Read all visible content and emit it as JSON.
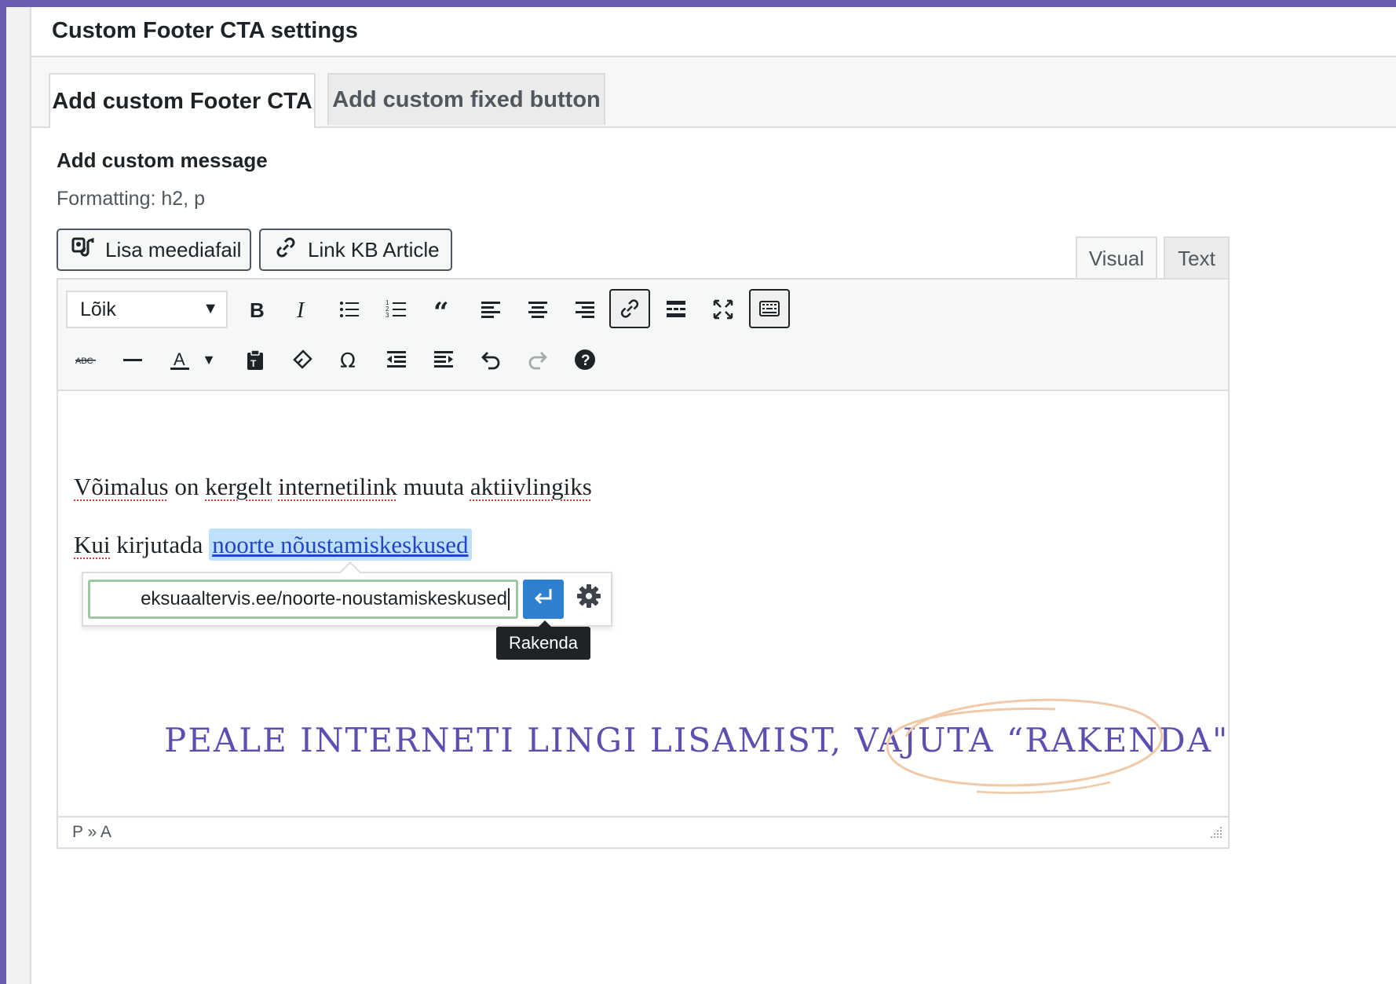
{
  "panel": {
    "title": "Custom Footer CTA settings"
  },
  "tabs": [
    {
      "label": "Add custom Footer CTA",
      "active": true
    },
    {
      "label": "Add custom fixed button",
      "active": false
    }
  ],
  "form": {
    "label": "Add custom message",
    "hint": "Formatting: h2, p"
  },
  "media_buttons": {
    "add_media": "Lisa meediafail",
    "link_kb": "Link KB Article"
  },
  "editor_tabs": {
    "visual": "Visual",
    "text": "Text"
  },
  "toolbar": {
    "format_select": "Lõik",
    "row1_icons": [
      "bold-icon",
      "italic-icon",
      "bullet-list-icon",
      "numbered-list-icon",
      "blockquote-icon",
      "align-left-icon",
      "align-center-icon",
      "align-right-icon",
      "link-icon",
      "read-more-icon",
      "fullscreen-icon",
      "toolbar-toggle-icon"
    ],
    "row2_icons": [
      "strikethrough-icon",
      "horizontal-line-icon",
      "text-color-icon",
      "paste-text-icon",
      "clear-formatting-icon",
      "special-character-icon",
      "outdent-icon",
      "indent-icon",
      "undo-icon",
      "redo-icon",
      "help-icon"
    ]
  },
  "content": {
    "p1_words": [
      "Võimalus",
      " on ",
      "kergelt",
      " ",
      "internetilink",
      " muuta ",
      "aktiivlingiks"
    ],
    "p2_prefix_word": "Kui",
    "p2_prefix_rest": " kirjutada ",
    "p2_link": "noorte nõustamiskeskused"
  },
  "link_popup": {
    "url_value": "eksuaaltervis.ee/noorte-noustamiskeskused",
    "apply_tooltip": "Rakenda"
  },
  "annotation": {
    "text": "PEALE INTERNETI LINGI LISAMIST, VAJUTA “RAKENDA\""
  },
  "statusbar": {
    "path": "P » A"
  },
  "colors": {
    "accent": "#6a5bb3",
    "annotation": "#5d4fb0",
    "circle": "#f0c9a8",
    "apply": "#2f7fd1"
  }
}
